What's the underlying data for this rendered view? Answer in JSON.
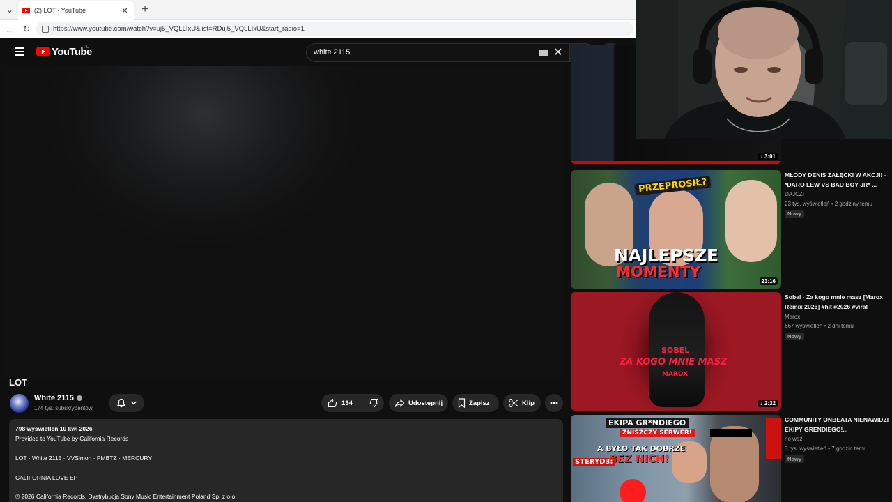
{
  "browser": {
    "tab_title": "(2) LOT - YouTube",
    "url": "https://www.youtube.com/watch?v=uj5_VQLLIxU&list=RDuj5_VQLLIxU&start_radio=1"
  },
  "youtube": {
    "logo_text": "YouTube",
    "country": "PL",
    "search_value": "white 2115"
  },
  "video": {
    "title": "LOT",
    "channel": "White 2115",
    "subscribers": "174 tys. subskrybentów",
    "likes": "134",
    "share_label": "Udostępnij",
    "save_label": "Zapisz",
    "clip_label": "Klip",
    "description": {
      "meta": "798 wyświetleń  10 kwi 2026",
      "line1": "Provided to YouTube by California Records",
      "line2": "LOT · White 2115 · VVSimon · PMBTZ · MERCURY",
      "line3": "CALIFORNIA LOVE EP",
      "line4": "℗ 2026 California Records. Dystrybucja Sony Music Entertainment Poland Sp. z o.o."
    }
  },
  "recommendations": [
    {
      "duration": "3:01"
    },
    {
      "title": "MŁODY DENIS ZAŁĘCKI W AKCJI! - *DARO LEW VS BAD BOY JR* ...",
      "channel": "DAJCZI",
      "meta": "23 tys. wyświetleń • 2 godziny temu",
      "badge": "Nowy",
      "duration": "23:16",
      "thumb_top": "PRZEPROSIŁ?",
      "thumb_main": "NAJLEPSZE",
      "thumb_sub": "MOMENTY"
    },
    {
      "title": "Sobel - Za kogo mnie masz [Marox Remix 2026] #hit #2026 #viral",
      "channel": "Marox",
      "meta": "667 wyświetleń • 2 dni temu",
      "badge": "Nowy",
      "duration": "2:32",
      "thumb_top": "SOBEL",
      "thumb_main": "ZA KOGO MNIE MASZ",
      "thumb_sub": "MAROX"
    },
    {
      "title": "COMMUNITY ONBEATA NIENAWIDZI EKIPY GRENDIEGO!...",
      "channel": "no weź",
      "meta": "3 tys. wyświetleń • 7 godzin temu",
      "badge": "Nowy",
      "thumb_top": "EKIPA GR*NDIEGO",
      "thumb_mid": "ZNISZCZY SERWER!",
      "thumb_main": "A BYŁO TAK DOBRZE",
      "thumb_sub": "BEZ NICH!",
      "thumb_tag": "STERYD3:"
    }
  ]
}
